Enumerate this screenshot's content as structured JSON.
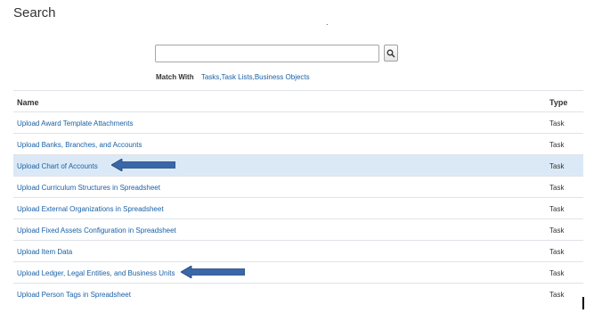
{
  "page": {
    "title": "Search"
  },
  "search": {
    "value": "",
    "placeholder": "",
    "button_icon": "magnifier-icon",
    "match_label": "Match With",
    "match_value": "Tasks,Task Lists,Business Objects"
  },
  "table": {
    "columns": [
      "Name",
      "Type"
    ],
    "rows": [
      {
        "name": "Upload Award Template Attachments",
        "type": "Task"
      },
      {
        "name": "Upload Banks, Branches, and Accounts",
        "type": "Task"
      },
      {
        "name": "Upload Chart of Accounts",
        "type": "Task"
      },
      {
        "name": "Upload Curriculum Structures in Spreadsheet",
        "type": "Task"
      },
      {
        "name": "Upload External Organizations in Spreadsheet",
        "type": "Task"
      },
      {
        "name": "Upload Fixed Assets Configuration in Spreadsheet",
        "type": "Task"
      },
      {
        "name": "Upload Item Data",
        "type": "Task"
      },
      {
        "name": "Upload Ledger, Legal Entities, and Business Units",
        "type": "Task"
      },
      {
        "name": "Upload Person Tags in Spreadsheet",
        "type": "Task"
      }
    ]
  },
  "colors": {
    "link": "#1a60a6",
    "selected_row": "#dbe9f7",
    "arrow": "#3a67a8"
  }
}
